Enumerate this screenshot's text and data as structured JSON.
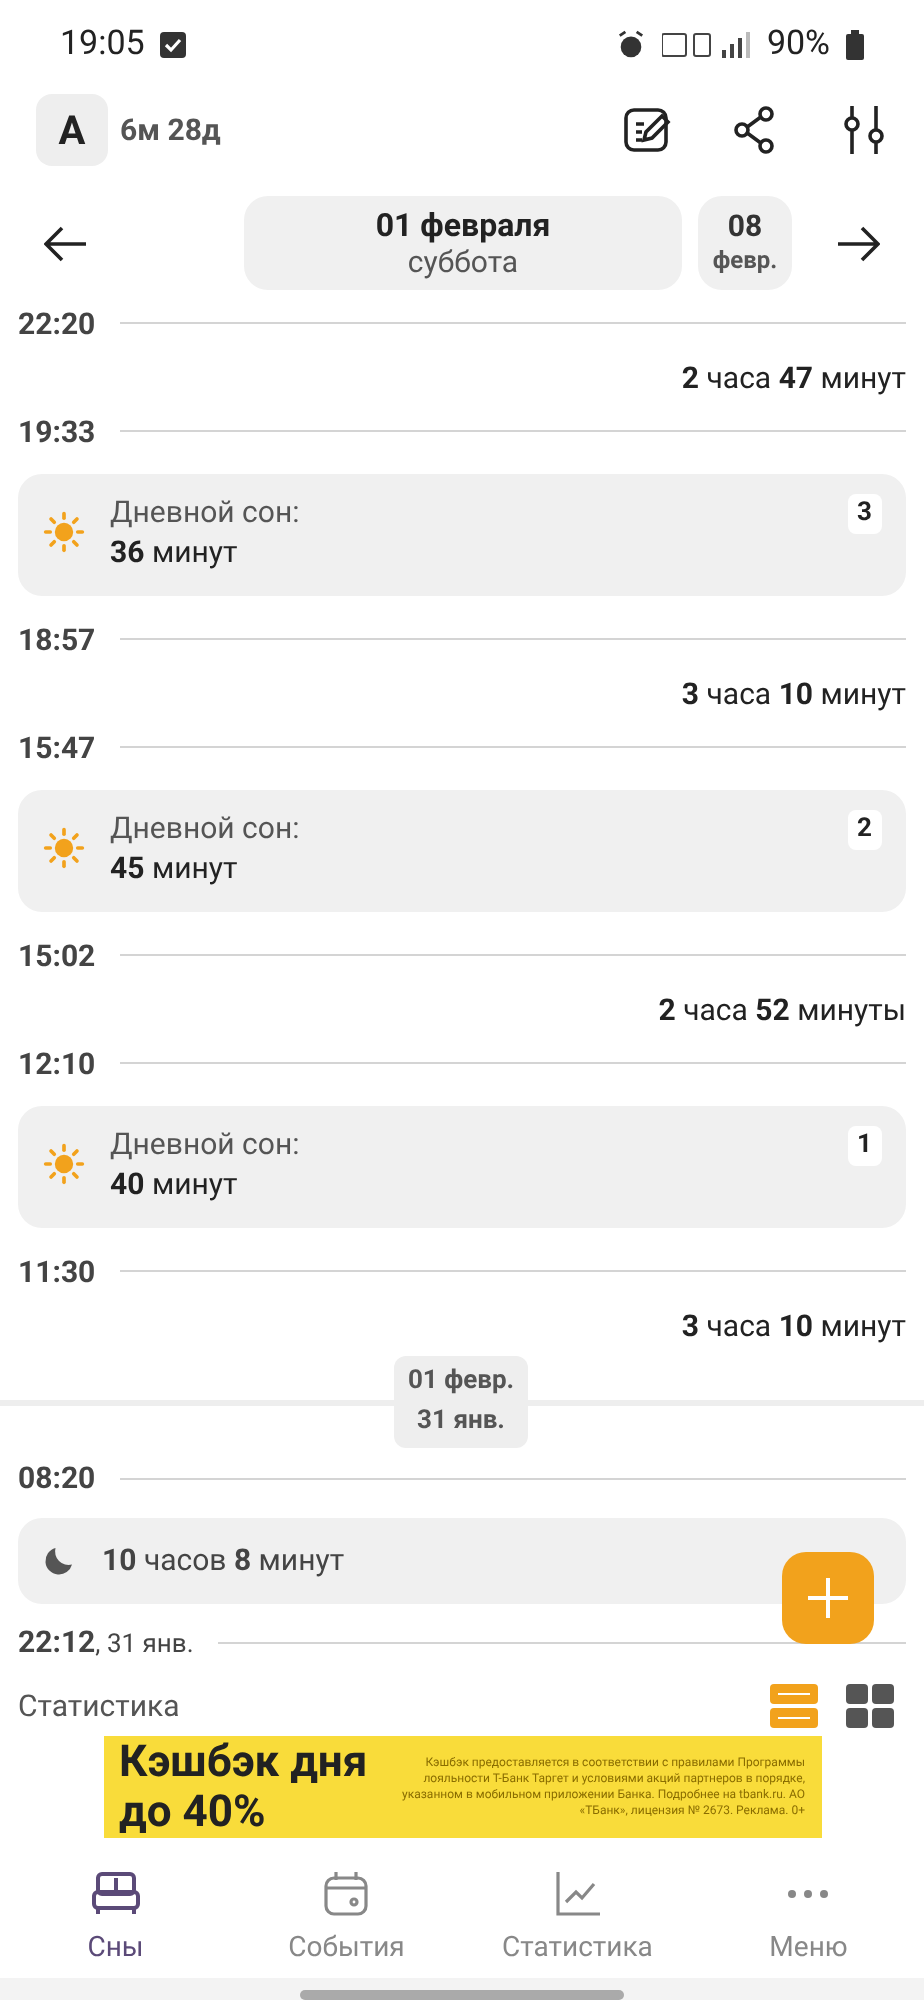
{
  "status_bar": {
    "time": "19:05",
    "battery": "90%"
  },
  "header": {
    "avatar_letter": "A",
    "age": "6м 28д"
  },
  "date_nav": {
    "current_date": "01 февраля",
    "current_weekday": "суббота",
    "next_day": "08",
    "next_month": "февр."
  },
  "timeline": [
    {
      "kind": "time",
      "time": "22:20"
    },
    {
      "kind": "gap",
      "text": "**2** часа **47** минут"
    },
    {
      "kind": "time",
      "time": "19:33"
    },
    {
      "kind": "nap",
      "label": "Дневной сон:",
      "text": "**36** минут",
      "badge": "3"
    },
    {
      "kind": "time",
      "time": "18:57"
    },
    {
      "kind": "gap",
      "text": "**3** часа **10** минут"
    },
    {
      "kind": "time",
      "time": "15:47"
    },
    {
      "kind": "nap",
      "label": "Дневной сон:",
      "text": "**45** минут",
      "badge": "2"
    },
    {
      "kind": "time",
      "time": "15:02"
    },
    {
      "kind": "gap",
      "text": "**2** часа **52** минуты"
    },
    {
      "kind": "time",
      "time": "12:10"
    },
    {
      "kind": "nap",
      "label": "Дневной сон:",
      "text": "**40** минут",
      "badge": "1"
    },
    {
      "kind": "time",
      "time": "11:30"
    },
    {
      "kind": "gap",
      "text": "**3** часа **10** минут"
    }
  ],
  "day_divider": {
    "upper": "01 февр.",
    "lower": "31 янв."
  },
  "previous_day": [
    {
      "kind": "time",
      "time": "08:20"
    },
    {
      "kind": "night",
      "text": "**10** часов **8** минут"
    },
    {
      "kind": "time",
      "time": "22:12",
      "date": ", 31 янв."
    }
  ],
  "stats_heading": "Статистика",
  "view_toggle": [
    {
      "selected": true
    },
    {
      "selected": false
    }
  ],
  "ad": {
    "headline": "Кэшбэк дня",
    "offer": "до 40%",
    "fine_print": "Кэшбэк предоставляется в соответствии с правилами Программы лояльности Т-Банк Таргет и условиями акций партнеров в порядке, указанном в мобильном приложении Банка. Подробнее на tbank.ru. АО «ТБанк», лицензия № 2673. Реклама. 0+"
  },
  "bottom_nav": [
    {
      "label": "Сны",
      "selected": true
    },
    {
      "label": "События",
      "selected": false
    },
    {
      "label": "Статистика",
      "selected": false
    },
    {
      "label": "Меню",
      "selected": false
    }
  ]
}
